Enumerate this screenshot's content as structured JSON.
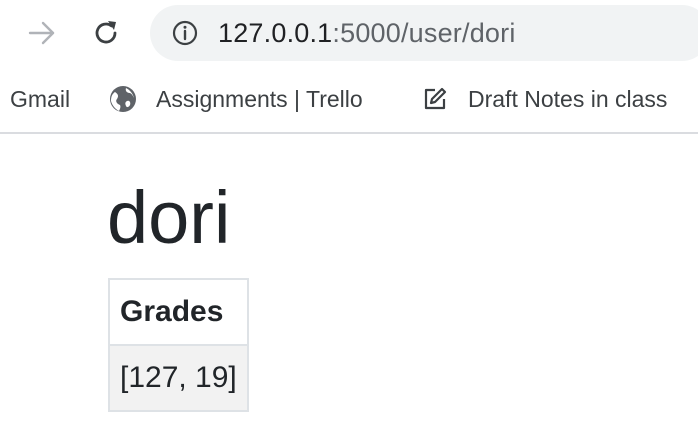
{
  "browser": {
    "url_host": "127.0.0.1",
    "url_path": ":5000/user/dori",
    "icons": {
      "forward": "arrow-forward-icon",
      "reload": "reload-icon",
      "info": "info-icon"
    }
  },
  "bookmarks": [
    {
      "label": "Gmail",
      "icon": null
    },
    {
      "label": "Assignments | Trello",
      "icon": "globe-icon"
    },
    {
      "label": "Draft Notes in class",
      "icon": "edit-icon"
    }
  ],
  "page": {
    "title": "dori",
    "table": {
      "headers": [
        "Grades"
      ],
      "rows": [
        [
          "[127, 19]"
        ]
      ]
    }
  },
  "colors": {
    "omnibox_bg": "#f1f3f4",
    "table_stripe": "#f2f2f2",
    "border": "#dee2e6"
  }
}
